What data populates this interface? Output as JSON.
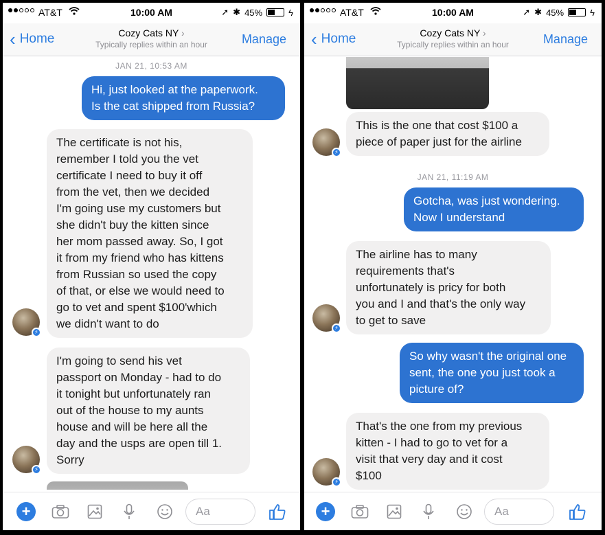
{
  "status": {
    "carrier": "AT&T",
    "time": "10:00 AM",
    "battery": "45%",
    "battery_level": 0.45
  },
  "nav": {
    "back_label": "Home",
    "title": "Cozy Cats NY",
    "subtitle": "Typically replies within an hour",
    "manage_label": "Manage"
  },
  "composer": {
    "placeholder": "Aa"
  },
  "left": {
    "timestamp": "JAN 21, 10:53 AM",
    "msg1": [
      "Hi, just looked at the paperwork.",
      "Is the cat shipped from Russia?"
    ],
    "msg2": [
      "The certificate is not his,",
      "remember I told you the vet",
      "certificate I need to buy it off",
      "from the vet, then we decided",
      "I'm going use my customers but",
      "she didn't buy the kitten since",
      "her mom passed away. So, I got",
      "it from my friend who has kittens",
      "from Russian so used the copy",
      "of that, or else we would need to",
      "go to vet and spent $100'which",
      "we didn't want to do"
    ],
    "msg3": [
      "I'm going to send his vet",
      "passport on Monday - had to do",
      "it tonight but unfortunately ran",
      "out of the house to my aunts",
      "house and will be here all the",
      "day and the usps are open till 1.",
      "Sorry"
    ]
  },
  "right": {
    "msg1": [
      "This is the one that cost $100 a",
      "piece of paper just for the airline"
    ],
    "timestamp": "JAN 21, 11:19 AM",
    "msg2": [
      "Gotcha, was just wondering.",
      "Now I understand"
    ],
    "msg3": [
      "The airline has to many",
      "requirements that's",
      "unfortunately is pricy for both",
      "you and I and that's the only way",
      "to get to save"
    ],
    "msg4": [
      "So why wasn't the original one",
      "sent, the one you just took a",
      "picture of?"
    ],
    "msg5": [
      "That's the one from my previous",
      "kitten - I had to go to vet for a",
      "visit that very day and it cost",
      "$100"
    ]
  },
  "colors": {
    "accent": "#2d7de0",
    "outgoing_bubble": "#2d73d1",
    "incoming_bubble": "#f1f0f0"
  },
  "icons": [
    "plus-icon",
    "camera-icon",
    "image-icon",
    "microphone-icon",
    "emoji-icon",
    "thumbs-up-icon",
    "messenger-badge-icon",
    "chevron-left-icon",
    "chevron-right-icon",
    "wifi-icon",
    "location-icon",
    "bluetooth-icon",
    "battery-icon"
  ]
}
